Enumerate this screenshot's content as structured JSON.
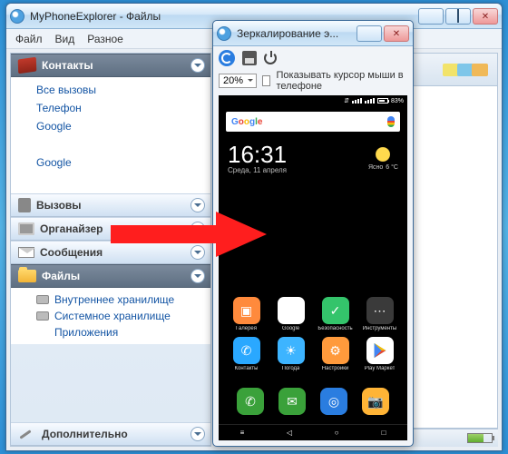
{
  "main_window": {
    "title": "MyPhoneExplorer -  Файлы",
    "menu": [
      "Файл",
      "Вид",
      "Разное"
    ]
  },
  "sidebar": {
    "sections": [
      {
        "label": "Контакты",
        "expanded": true,
        "dark": true,
        "icon": "book",
        "items": [
          {
            "label": "Все вызовы"
          },
          {
            "label": "Телефон"
          },
          {
            "label": "Google"
          },
          {
            "label": "",
            "dim": true
          },
          {
            "label": "Google"
          },
          {
            "label": "",
            "dim": true
          }
        ]
      },
      {
        "label": "Вызовы",
        "icon": "phone"
      },
      {
        "label": "Органайзер",
        "icon": "chips"
      },
      {
        "label": "Сообщения",
        "icon": "mail"
      },
      {
        "label": "Файлы",
        "expanded": true,
        "dark": true,
        "icon": "folder",
        "subs": [
          {
            "label": "Внутреннее хранилище",
            "disk": true
          },
          {
            "label": "Системное хранилище",
            "disk": true
          },
          {
            "label": "Приложения",
            "disk": false
          }
        ]
      },
      {
        "label": "Дополнительно",
        "icon": "tool"
      }
    ]
  },
  "mirror_window": {
    "title": "Зеркалирование э...",
    "zoom": "20%",
    "cursor_label": "Показывать курсор мыши в телефоне"
  },
  "phone": {
    "status": {
      "battery": "83%",
      "time": ""
    },
    "search_brand": "Google",
    "clock": "16:31",
    "date": "Среда, 11 апреля",
    "weather": {
      "cond": "Ясно",
      "temp": "6 °C"
    },
    "apps": [
      {
        "label": "Галерея",
        "bg": "#ff8a3c",
        "glyph": "▣"
      },
      {
        "label": "Google",
        "bg": "#fff",
        "glyph": ""
      },
      {
        "label": "Безопасность",
        "bg": "#34c46b",
        "glyph": "✓"
      },
      {
        "label": "Инструменты",
        "bg": "#3a3a3a",
        "glyph": "⋯"
      },
      {
        "label": "Контакты",
        "bg": "#2aa8ff",
        "glyph": "✆"
      },
      {
        "label": "Погода",
        "bg": "#3db4ff",
        "glyph": "☀"
      },
      {
        "label": "Настройки",
        "bg": "#ff9a3c",
        "glyph": "⚙"
      },
      {
        "label": "Play Маркет",
        "bg": "#fff",
        "glyph": "▶"
      }
    ],
    "dock": [
      {
        "bg": "#3aa13a",
        "glyph": "✆"
      },
      {
        "bg": "#3aa13a",
        "glyph": "✉"
      },
      {
        "bg": "#2a7de0",
        "glyph": "◎"
      },
      {
        "bg": "#ffb436",
        "glyph": "📷"
      }
    ],
    "nav": [
      "menu",
      "back",
      "home",
      "recent"
    ]
  }
}
